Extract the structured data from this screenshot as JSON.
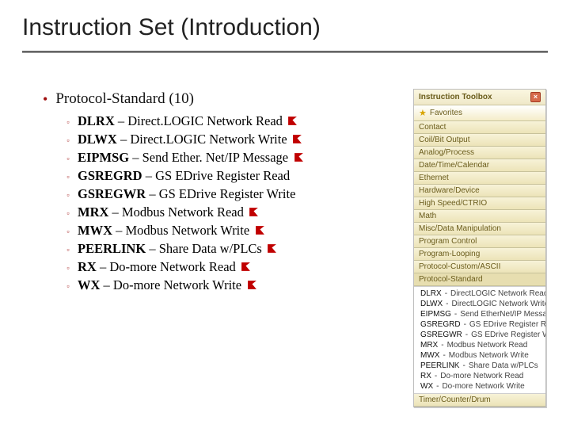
{
  "title": "Instruction Set (Introduction)",
  "main_item": "Protocol-Standard (10)",
  "sub_items": [
    {
      "code": "DLRX",
      "desc": " – Direct.LOGIC Network Read",
      "flag": true
    },
    {
      "code": "DLWX",
      "desc": " – Direct.LOGIC Network Write",
      "flag": true
    },
    {
      "code": "EIPMSG",
      "desc": " – Send Ether. Net/IP Message",
      "flag": true
    },
    {
      "code": "GSREGRD",
      "desc": " – GS EDrive Register Read",
      "flag": false
    },
    {
      "code": "GSREGWR",
      "desc": " – GS EDrive Register Write",
      "flag": false
    },
    {
      "code": "MRX",
      "desc": " – Modbus Network Read",
      "flag": true
    },
    {
      "code": "MWX",
      "desc": " – Modbus Network Write",
      "flag": true
    },
    {
      "code": "PEERLINK",
      "desc": " – Share Data w/PLCs",
      "flag": true
    },
    {
      "code": "RX",
      "desc": " – Do-more Network Read",
      "flag": true
    },
    {
      "code": "WX",
      "desc": " – Do-more Network Write",
      "flag": true
    }
  ],
  "panel": {
    "title": "Instruction Toolbox",
    "favorites": "Favorites",
    "categories": [
      "Contact",
      "Coil/Bit Output",
      "Analog/Process",
      "Date/Time/Calendar",
      "Ethernet",
      "Hardware/Device",
      "High Speed/CTRIO",
      "Math",
      "Misc/Data Manipulation",
      "Program Control",
      "Program-Looping",
      "Protocol-Custom/ASCII",
      "Protocol-Standard"
    ],
    "leaves": [
      {
        "code": "DLRX",
        "desc": "DirectLOGIC Network Read"
      },
      {
        "code": "DLWX",
        "desc": "DirectLOGIC Network Write"
      },
      {
        "code": "EIPMSG",
        "desc": "Send EtherNet/IP Message"
      },
      {
        "code": "GSREGRD",
        "desc": "GS EDrive Register Read"
      },
      {
        "code": "GSREGWR",
        "desc": "GS EDrive Register Write"
      },
      {
        "code": "MRX",
        "desc": "Modbus Network Read"
      },
      {
        "code": "MWX",
        "desc": "Modbus Network Write"
      },
      {
        "code": "PEERLINK",
        "desc": "Share Data w/PLCs"
      },
      {
        "code": "RX",
        "desc": "Do-more Network Read"
      },
      {
        "code": "WX",
        "desc": "Do-more Network Write"
      }
    ],
    "footer": "Timer/Counter/Drum"
  }
}
